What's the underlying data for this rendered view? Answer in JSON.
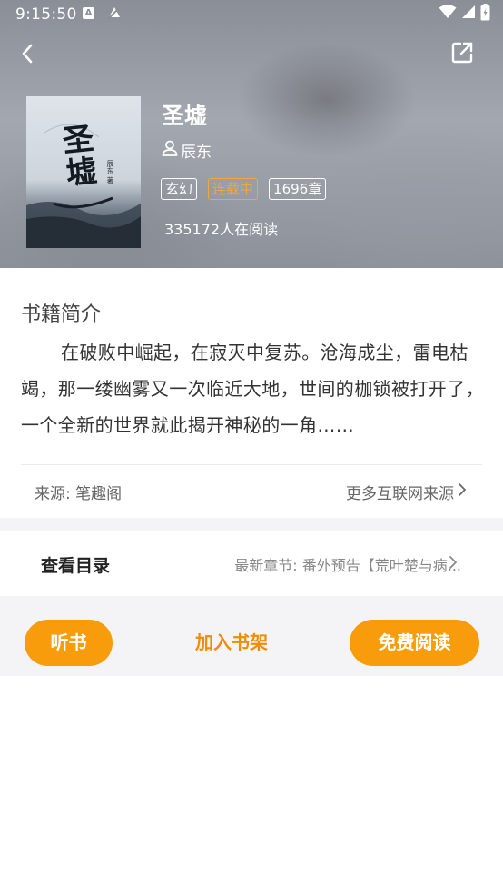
{
  "status_bar": {
    "time": "9:15:50",
    "notif_a": "A",
    "icons": [
      "wifi-icon",
      "signal-icon",
      "battery-icon"
    ]
  },
  "header": {
    "back_icon": "chevron-left-icon",
    "share_icon": "external-share-icon"
  },
  "book": {
    "title": "圣墟",
    "author": "辰东",
    "tags": [
      "玄幻",
      "连载中",
      "1696章"
    ],
    "readers": "335172人在阅读",
    "cover_text": "圣墟",
    "cover_author": "辰东 著"
  },
  "intro": {
    "heading": "书籍简介",
    "text": "在破败中崛起，在寂灭中复苏。沧海成尘，雷电枯竭，那一缕幽雾又一次临近大地，世间的枷锁被打开了，一个全新的世界就此揭开神秘的一角……",
    "source": "来源: 笔趣阁",
    "more_source": "更多互联网来源"
  },
  "catalog": {
    "label": "查看目录",
    "latest": "最新章节: 番外预告【荒叶楚与病..."
  },
  "actions": {
    "listen": "听书",
    "shelf": "加入书架",
    "read": "免费阅读"
  },
  "colors": {
    "accent": "#f89c0c",
    "status_tag": "#f3a63a"
  }
}
